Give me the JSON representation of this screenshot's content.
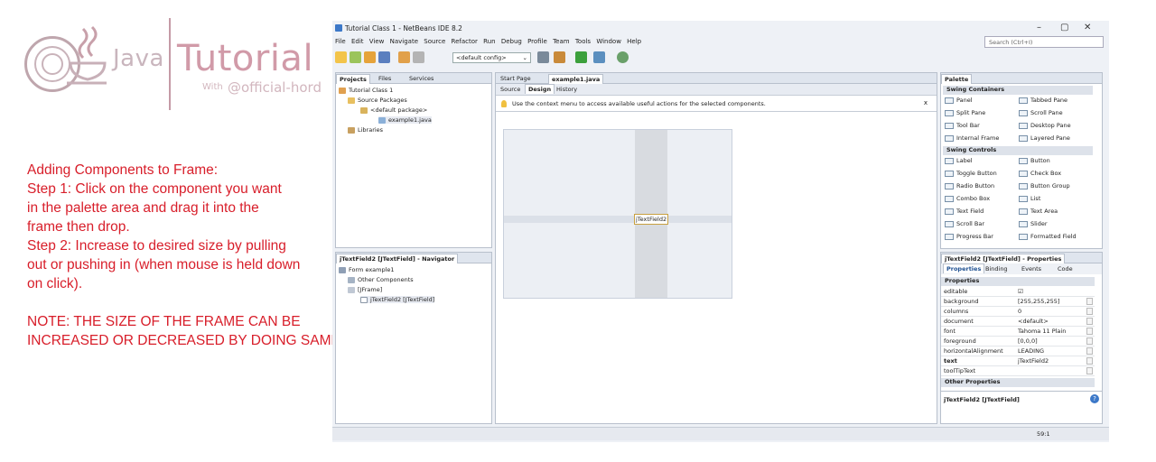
{
  "brand": {
    "java": "Java",
    "tutorial": "Tutorial",
    "with": "With",
    "handle": "@official-hord"
  },
  "instructions": {
    "line1": "Adding Components to Frame:",
    "line2": "Step 1: Click on the component you want",
    "line3": "in the palette area and drag it into the",
    "line4": "frame then drop.",
    "line5": "Step 2: Increase to desired size by pulling",
    "line6": "out or pushing in (when mouse is held down",
    "line7": "on click).",
    "note1": "NOTE: THE SIZE OF THE FRAME CAN BE",
    "note2": "INCREASED OR DECREASED BY DOING SAME"
  },
  "ide": {
    "title": "Tutorial Class 1 - NetBeans IDE 8.2",
    "window_controls": [
      "–",
      "▢",
      "✕"
    ],
    "menu": [
      "File",
      "Edit",
      "View",
      "Navigate",
      "Source",
      "Refactor",
      "Run",
      "Debug",
      "Profile",
      "Team",
      "Tools",
      "Window",
      "Help"
    ],
    "search_placeholder": "Search (Ctrl+I)",
    "config": "<default config>",
    "projects_tabs": [
      "Projects",
      "Files",
      "Services"
    ],
    "project_tree": [
      "Tutorial Class 1",
      "Source Packages",
      "<default package>",
      "example1.java",
      "Libraries"
    ],
    "navigator_title": "jTextField2 [JTextField] - Navigator",
    "navigator_tree": [
      "Form example1",
      "Other Components",
      "[JFrame]",
      "jTextField2 [JTextField]"
    ],
    "editor_tabs": [
      "Start Page",
      "example1.java"
    ],
    "editor_views": [
      "Source",
      "Design",
      "History"
    ],
    "hint": "Use the context menu to access available useful actions for the selected components.",
    "hint_close": "x",
    "component_label": "jTextField2",
    "palette_title": "Palette",
    "palette_groups": [
      "Swing Containers",
      "Swing Controls"
    ],
    "swing_containers": [
      "Panel",
      "Tabbed Pane",
      "Split Pane",
      "Scroll Pane",
      "Tool Bar",
      "Desktop Pane",
      "Internal Frame",
      "Layered Pane"
    ],
    "swing_controls": [
      "Label",
      "Button",
      "Toggle Button",
      "Check Box",
      "Radio Button",
      "Button Group",
      "Combo Box",
      "List",
      "Text Field",
      "Text Area",
      "Scroll Bar",
      "Slider",
      "Progress Bar",
      "Formatted Field"
    ],
    "properties_title": "jTextField2 [JTextField] - Properties",
    "properties_tabs": [
      "Properties",
      "Binding",
      "Events",
      "Code"
    ],
    "properties_section": "Properties",
    "properties": [
      {
        "k": "editable",
        "v": "☑"
      },
      {
        "k": "background",
        "v": "[255,255,255]"
      },
      {
        "k": "columns",
        "v": "0"
      },
      {
        "k": "document",
        "v": "<default>"
      },
      {
        "k": "font",
        "v": "Tahoma 11 Plain"
      },
      {
        "k": "foreground",
        "v": "[0,0,0]"
      },
      {
        "k": "horizontalAlignment",
        "v": "LEADING"
      },
      {
        "k": "text",
        "v": "jTextField2"
      },
      {
        "k": "toolTipText",
        "v": ""
      }
    ],
    "other_properties": "Other Properties",
    "selected_component": "jTextField2 [JTextField]",
    "status_position": "59:1",
    "colors": {
      "accent": "#3c78c8",
      "instruction_red": "#d81e2a",
      "brand_pink": "#d19aa8"
    }
  }
}
